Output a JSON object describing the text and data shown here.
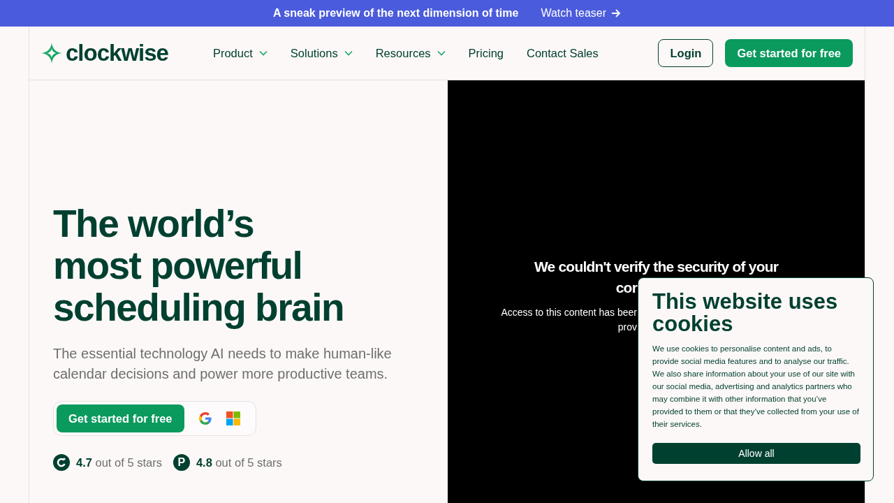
{
  "announcement": {
    "text": "A sneak preview of the next dimension of time",
    "link": "Watch teaser"
  },
  "nav": {
    "logo": "clockwise",
    "items": [
      {
        "label": "Product",
        "kind": "menu"
      },
      {
        "label": "Solutions",
        "kind": "menu"
      },
      {
        "label": "Resources",
        "kind": "menu"
      },
      {
        "label": "Pricing",
        "kind": "link"
      },
      {
        "label": "Contact Sales",
        "kind": "link"
      }
    ],
    "login": "Login",
    "cta": "Get started for free"
  },
  "hero": {
    "title_lines": [
      "The world’s",
      "most powerful",
      "scheduling brain"
    ],
    "subtitle": "The essential technology AI needs to make human-like calendar decisions and power more productive teams.",
    "cta": "Get started for free",
    "ratings": [
      {
        "kind": "g2",
        "text": "**4.7** out of 5 stars"
      },
      {
        "kind": "badge",
        "badge": "P",
        "text": "**4.8** out of 5 stars"
      }
    ]
  },
  "video_error": {
    "lines": [
      "We couldn't verify the security of your",
      "cor"
    ],
    "detail_lines": [
      "Access to this content has beer",
      "prov"
    ]
  },
  "cookie_dialog": {
    "title": "This website uses cookies",
    "body": "We use cookies to personalise content and ads, to provide social media features and to analyse our traffic. We also share information about your use of our site with our social media, advertising and analytics partners who may combine it with other information that you’ve provided to them or that they’ve collected from your use of their services.",
    "button": "Allow all"
  }
}
